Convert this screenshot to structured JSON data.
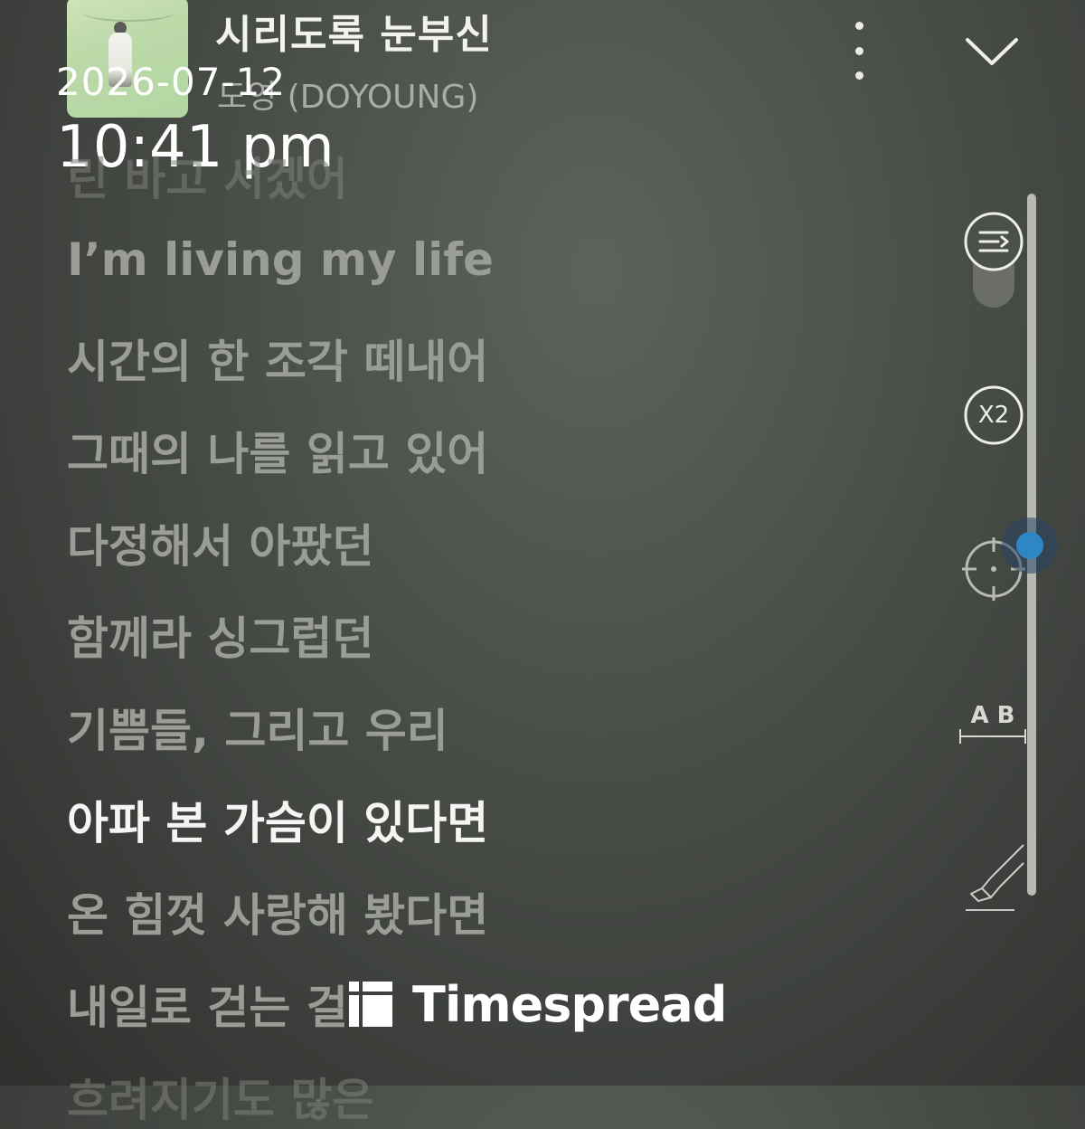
{
  "header": {
    "song_title": "시리도록 눈부신",
    "artist": "도영 (DOYOUNG)"
  },
  "overlay": {
    "date": "2026-07-12",
    "time": "10:41 pm"
  },
  "lyrics": [
    {
      "text": "린 바고 서겠어",
      "state": "faded"
    },
    {
      "text": "I’m living my life",
      "state": "past"
    },
    {
      "text": "시간의 한 조각 떼내어",
      "state": "past"
    },
    {
      "text": "그때의 나를 읽고 있어",
      "state": "past"
    },
    {
      "text": "다정해서 아팠던",
      "state": "past"
    },
    {
      "text": "함께라 싱그럽던",
      "state": "past"
    },
    {
      "text": "기쁨들, 그리고 우리",
      "state": "past"
    },
    {
      "text": "아파 본 가슴이 있다면",
      "state": "current"
    },
    {
      "text": "온 힘껏 사랑해 봤다면",
      "state": "upcoming"
    },
    {
      "text": "내일로 걷는 걸",
      "state": "upcoming"
    },
    {
      "text": "흐려지기도 많은",
      "state": "faded"
    }
  ],
  "controls": {
    "speed_label": "X2",
    "ab_label": "A B",
    "scroll_position_fraction": 0.5
  },
  "watermark": {
    "text": "Timespread"
  },
  "colors": {
    "current_lyric": "#f5f5f3",
    "past_lyric": "#9a9d97",
    "scroll_accent": "#2f86c5"
  }
}
